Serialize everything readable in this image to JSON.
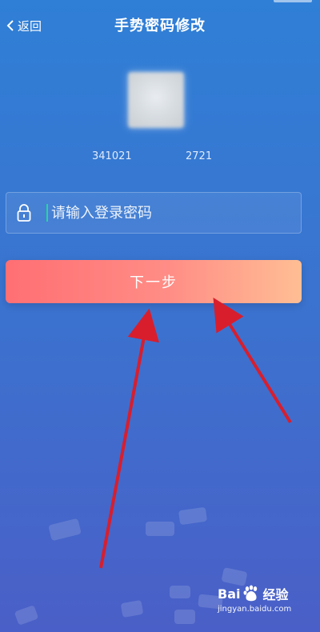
{
  "nav": {
    "back_label": "返回",
    "title": "手势密码修改"
  },
  "account": {
    "left_fragment": "341021",
    "right_fragment": "2721"
  },
  "password": {
    "placeholder": "请输入登录密码",
    "value": ""
  },
  "actions": {
    "next_label": "下一步"
  },
  "watermark": {
    "brand_left": "Bai",
    "brand_right": "经验",
    "url": "jingyan.baidu.com"
  },
  "colors": {
    "button_start": "#ff6f73",
    "button_end": "#ffbe94",
    "background_top": "#2f7fd6",
    "arrow": "#d81e2d"
  }
}
